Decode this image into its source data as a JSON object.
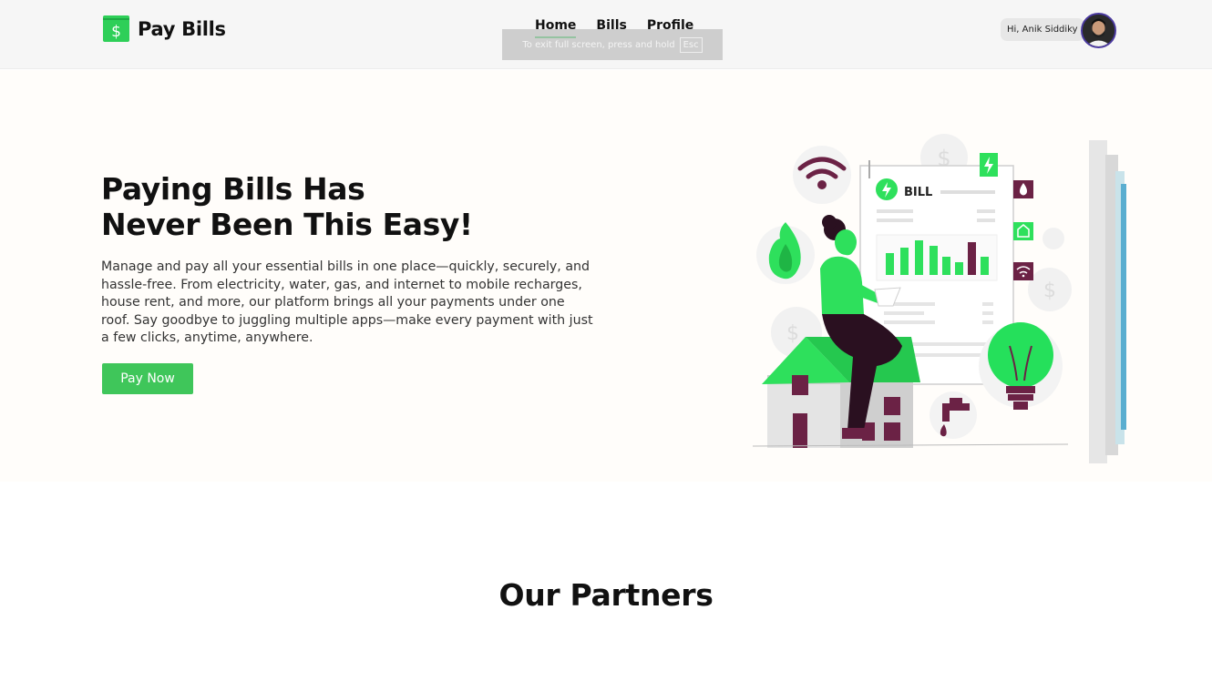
{
  "brand": {
    "name": "Pay Bills",
    "icon": "dollar-wallet-icon",
    "color": "#2ecf58"
  },
  "nav": {
    "links": [
      {
        "label": "Home",
        "active": true
      },
      {
        "label": "Bills",
        "active": false
      },
      {
        "label": "Profile",
        "active": false
      }
    ]
  },
  "fullscreen_hint": {
    "text": "To exit full screen, press and hold",
    "key": "Esc"
  },
  "user": {
    "greeting": "Hi, Anik Siddiky",
    "avatar_icon": "user-avatar"
  },
  "hero": {
    "title_line1": "Paying Bills Has",
    "title_line2": "Never Been This Easy!",
    "description": "Manage and pay all your essential bills in one place—quickly, securely, and hassle-free. From electricity, water, gas, and internet to mobile recharges, house rent, and more, our platform brings all your payments under one roof. Say goodbye to juggling multiple apps—make every payment with just a few clicks, anytime, anywhere.",
    "cta_label": "Pay Now",
    "illustration": {
      "bill_label": "BILL"
    }
  },
  "partners": {
    "title": "Our Partners"
  },
  "colors": {
    "accent": "#3fc65a",
    "plum": "#6b2245",
    "bulb": "#25e05b"
  }
}
